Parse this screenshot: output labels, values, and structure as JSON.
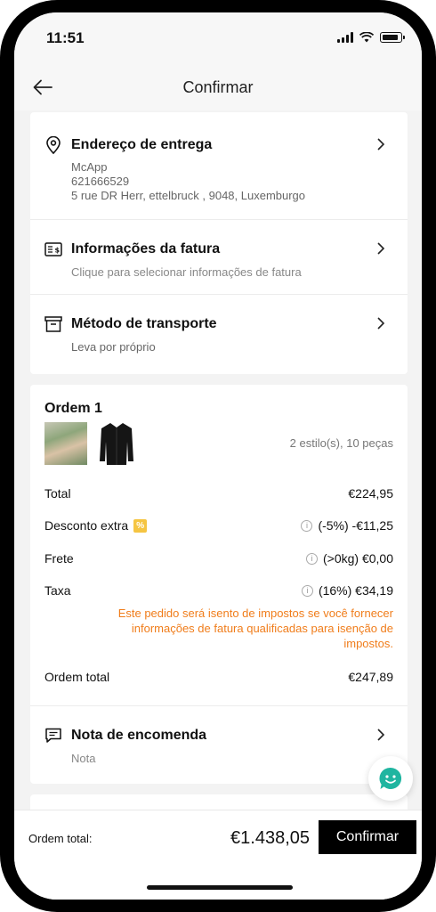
{
  "status": {
    "time": "11:51"
  },
  "header": {
    "title": "Confirmar",
    "back_icon": "arrow-left-icon"
  },
  "address": {
    "title": "Endereço de entrega",
    "name": "McApp",
    "phone": "621666529",
    "line": "5 rue DR Herr, ettelbruck , 9048, Luxemburgo"
  },
  "invoice": {
    "title": "Informações da fatura",
    "subtitle": "Clique para selecionar informações de fatura"
  },
  "shipping": {
    "title": "Método de transporte",
    "subtitle": "Leva por próprio"
  },
  "order": {
    "title": "Ordem 1",
    "summary": "2 estilo(s), 10 peças",
    "total_label": "Total",
    "total_value": "€224,95",
    "discount_label": "Desconto extra",
    "discount_badge": "%",
    "discount_value": "(-5%) -€11,25",
    "freight_label": "Frete",
    "freight_value": "(>0kg) €0,00",
    "tax_label": "Taxa",
    "tax_value": "(16%) €34,19",
    "tax_notice": "Este pedido será isento de impostos se você fornecer informações de fatura qualificadas para isenção de impostos.",
    "order_total_label": "Ordem total",
    "order_total_value": "€247,89"
  },
  "note": {
    "title": "Nota de encomenda",
    "subtitle": "Nota"
  },
  "footer": {
    "label": "Ordem total:",
    "amount": "€1.438,05",
    "confirm_label": "Confirmar"
  },
  "colors": {
    "accent_notice": "#f07d1b",
    "badge": "#f5c542",
    "chat": "#1fb5a0"
  }
}
